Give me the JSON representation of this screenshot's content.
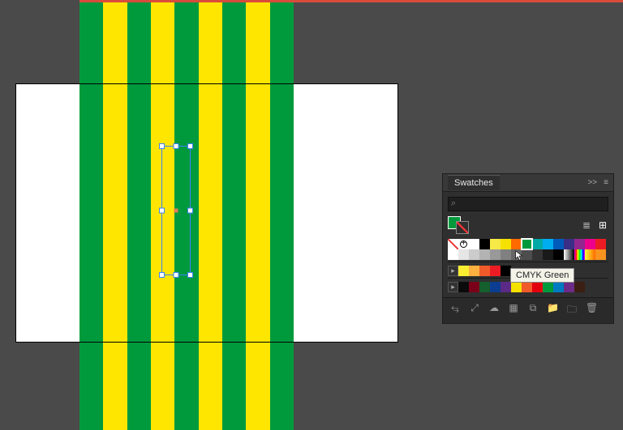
{
  "artwork": {
    "stripe_colors": [
      "#009a3d",
      "#ffe600",
      "#009a3d",
      "#ffe600",
      "#009a3d",
      "#ffe600",
      "#009a3d",
      "#ffe600",
      "#009a3d"
    ]
  },
  "panel": {
    "title": "Swatches",
    "header_expand": ">>",
    "header_menu": "≡",
    "search_placeholder": "",
    "current_fill": "#009a3d",
    "view_icons": {
      "list": "≣",
      "grid": "⊞"
    },
    "tooltip": "CMYK Green",
    "rows": [
      [
        {
          "t": "none"
        },
        {
          "t": "reg"
        },
        {
          "c": "#ffffff"
        },
        {
          "c": "#000000"
        },
        {
          "c": "#f7e948"
        },
        {
          "c": "#f6e100"
        },
        {
          "c": "#ff6a00"
        },
        {
          "c": "#009a3d",
          "sel": true
        },
        {
          "c": "#00a9a5"
        },
        {
          "c": "#00adef"
        },
        {
          "c": "#005bbb"
        },
        {
          "c": "#3b2e86"
        },
        {
          "c": "#92278f"
        },
        {
          "c": "#ec008c"
        },
        {
          "c": "#ed1c24"
        }
      ],
      [
        {
          "c": "#ffffff"
        },
        {
          "c": "#e6e6e6"
        },
        {
          "c": "#cccccc"
        },
        {
          "c": "#b3b3b3"
        },
        {
          "c": "#999999"
        },
        {
          "c": "#808080"
        },
        {
          "c": "#666666"
        },
        {
          "c": "#4d4d4d"
        },
        {
          "c": "#333333"
        },
        {
          "c": "#1a1a1a"
        },
        {
          "c": "#000000"
        },
        {
          "t": "grad-bw"
        },
        {
          "t": "grad-rainbow"
        },
        {
          "t": "grad-sun"
        },
        {
          "c": "#f7931e"
        }
      ],
      [
        {
          "t": "group"
        },
        {
          "c": "#f9ed32"
        },
        {
          "c": "#fbb040"
        },
        {
          "c": "#f15a29"
        },
        {
          "c": "#ed1c24"
        },
        {
          "c": "#000000"
        }
      ],
      [
        {
          "t": "group"
        },
        {
          "c": "#0b0b0b"
        },
        {
          "c": "#7a0019"
        },
        {
          "c": "#155e2d"
        },
        {
          "c": "#0b3d91"
        },
        {
          "c": "#5b2a86"
        },
        {
          "c": "#f5e100"
        },
        {
          "c": "#f15a29"
        },
        {
          "c": "#e2000f"
        },
        {
          "c": "#009a3d"
        },
        {
          "c": "#007ac1"
        },
        {
          "c": "#6c2b86"
        },
        {
          "c": "#3b1f13"
        }
      ]
    ],
    "footer_icons": [
      "⥃",
      "⤢",
      "☁",
      "▦",
      "⧉",
      "📁",
      "🗀",
      "🗑"
    ]
  }
}
